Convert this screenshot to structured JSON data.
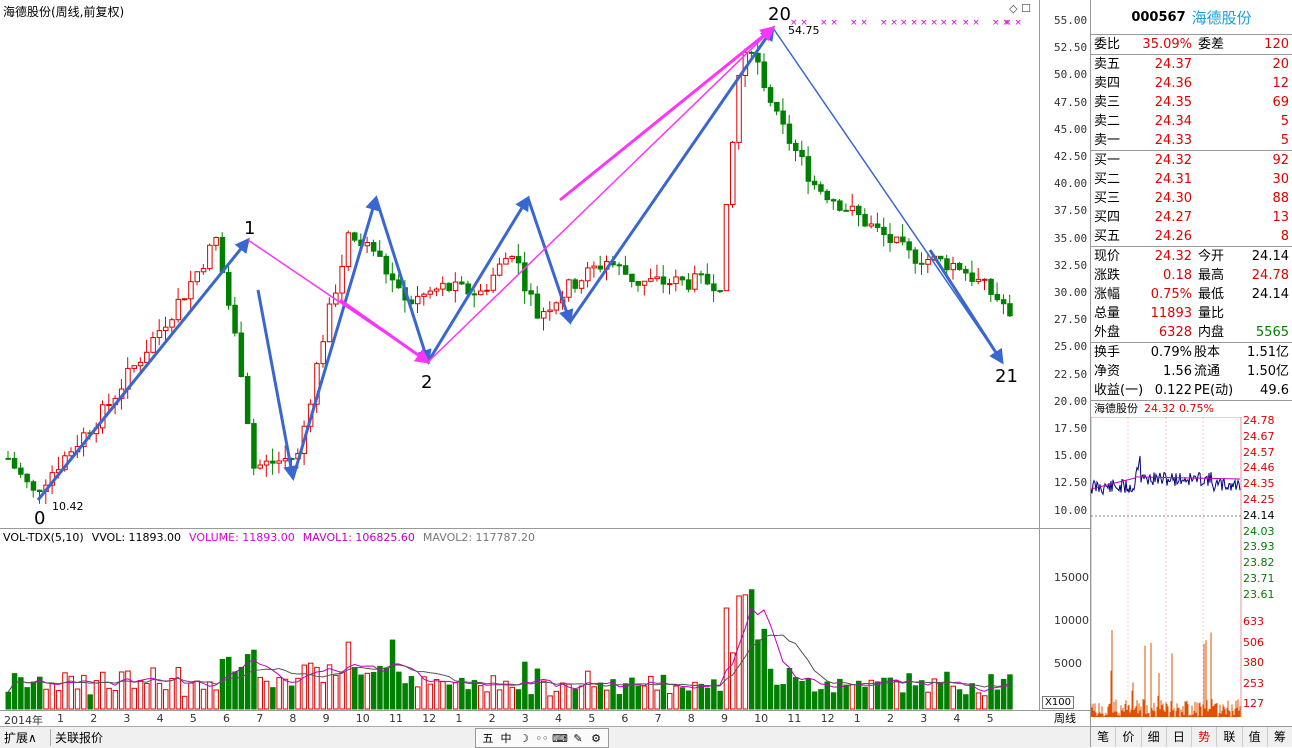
{
  "main": {
    "title": "海德股份(周线,前复权)",
    "options_icon": "◇ ☐",
    "annotations": {
      "low_label": "10.42",
      "high_label": "54.75",
      "n0": "0",
      "n1": "1",
      "n2": "2",
      "n20": "20",
      "n21": "21"
    }
  },
  "price_axis": [
    "55.00",
    "52.50",
    "50.00",
    "47.50",
    "45.00",
    "42.50",
    "40.00",
    "37.50",
    "35.00",
    "32.50",
    "30.00",
    "27.50",
    "25.00",
    "22.50",
    "20.00",
    "17.50",
    "15.00",
    "12.50",
    "10.00"
  ],
  "volume_panel": {
    "indicator": "VOL-TDX(5,10)",
    "vvol": "VVOL: 11893.00",
    "volume": "VOLUME: 11893.00",
    "mavol1": "MAVOL1: 106825.60",
    "mavol2": "MAVOL2: 117787.20",
    "ticks": [
      "15000",
      "10000",
      "5000"
    ],
    "scale": "X100"
  },
  "date_axis": {
    "year": "2014年",
    "months": [
      "1",
      "2",
      "3",
      "4",
      "5",
      "6",
      "7",
      "8",
      "9",
      "10",
      "11",
      "12",
      "1",
      "2",
      "3",
      "4",
      "5",
      "6",
      "7",
      "8",
      "9",
      "10",
      "11",
      "12",
      "1",
      "2",
      "3",
      "4",
      "5"
    ]
  },
  "period": "周线",
  "bottom_tabs": {
    "expand": "扩展∧",
    "linked": "关联报价"
  },
  "toolbar_icons": [
    "五",
    "中",
    "☽",
    "◦◦",
    "⌨",
    "✎",
    "⚙"
  ],
  "quote": {
    "code": "000567",
    "name": "海德股份",
    "weibi_label": "委比",
    "weibi": "35.09%",
    "weicha_label": "委差",
    "weicha": "120",
    "asks": [
      {
        "label": "卖五",
        "price": "24.37",
        "vol": "20"
      },
      {
        "label": "卖四",
        "price": "24.36",
        "vol": "12"
      },
      {
        "label": "卖三",
        "price": "24.35",
        "vol": "69"
      },
      {
        "label": "卖二",
        "price": "24.34",
        "vol": "5"
      },
      {
        "label": "卖一",
        "price": "24.33",
        "vol": "5"
      }
    ],
    "bids": [
      {
        "label": "买一",
        "price": "24.32",
        "vol": "92"
      },
      {
        "label": "买二",
        "price": "24.31",
        "vol": "30"
      },
      {
        "label": "买三",
        "price": "24.30",
        "vol": "88"
      },
      {
        "label": "买四",
        "price": "24.27",
        "vol": "13"
      },
      {
        "label": "买五",
        "price": "24.26",
        "vol": "8"
      }
    ],
    "stats": [
      {
        "l1": "现价",
        "v1": "24.32",
        "l2": "今开",
        "v2": "24.14",
        "c1": "red",
        "c2": ""
      },
      {
        "l1": "涨跌",
        "v1": "0.18",
        "l2": "最高",
        "v2": "24.78",
        "c1": "red",
        "c2": "red"
      },
      {
        "l1": "涨幅",
        "v1": "0.75%",
        "l2": "最低",
        "v2": "24.14",
        "c1": "red",
        "c2": ""
      },
      {
        "l1": "总量",
        "v1": "11893",
        "l2": "量比",
        "v2": "",
        "c1": "red",
        "c2": ""
      },
      {
        "l1": "外盘",
        "v1": "6328",
        "l2": "内盘",
        "v2": "5565",
        "c1": "red",
        "c2": "green"
      }
    ],
    "fund": [
      {
        "l1": "换手",
        "v1": "0.79%",
        "l2": "股本",
        "v2": "1.51亿"
      },
      {
        "l1": "净资",
        "v1": "1.56",
        "l2": "流通",
        "v2": "1.50亿"
      },
      {
        "l1": "收益(一)",
        "v1": "0.122",
        "l2": "PE(动)",
        "v2": "49.6"
      }
    ]
  },
  "mini": {
    "name": "海德股份",
    "price": "24.32",
    "pct": "0.75%",
    "price_ticks": [
      "24.78",
      "24.67",
      "24.57",
      "24.46",
      "24.35",
      "24.25",
      "24.14",
      "24.03",
      "23.93",
      "23.82",
      "23.71",
      "23.61"
    ],
    "vol_ticks": [
      "633",
      "506",
      "380",
      "253",
      "127"
    ]
  },
  "right_tabs": [
    "笔",
    "价",
    "细",
    "日",
    "势",
    "联",
    "值",
    "筹"
  ],
  "colors": {
    "up": "#e00000",
    "down": "#008000",
    "arrow_blue": "#3a66d0",
    "arrow_magenta": "#ff33ff",
    "ma1": "#c000c0",
    "ma2": "#555555",
    "mini_line": "#000080",
    "mini_avg": "#c000c0",
    "mini_vol": "#e05000"
  }
}
